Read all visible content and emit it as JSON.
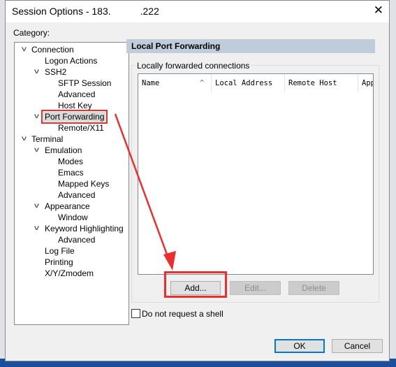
{
  "window": {
    "title": "Session Options - 183.   .222",
    "close_icon": "close-icon"
  },
  "category_label": "Category:",
  "tree": [
    {
      "label": "Connection",
      "level": 0,
      "expanded": true
    },
    {
      "label": "Logon Actions",
      "level": 1
    },
    {
      "label": "SSH2",
      "level": 1,
      "expanded": true
    },
    {
      "label": "SFTP Session",
      "level": 2
    },
    {
      "label": "Advanced",
      "level": 2
    },
    {
      "label": "Host Key",
      "level": 2
    },
    {
      "label": "Port Forwarding",
      "level": 1,
      "expanded": true,
      "selected": true
    },
    {
      "label": "Remote/X11",
      "level": 2
    },
    {
      "label": "Terminal",
      "level": 0,
      "expanded": true
    },
    {
      "label": "Emulation",
      "level": 1,
      "expanded": true
    },
    {
      "label": "Modes",
      "level": 2
    },
    {
      "label": "Emacs",
      "level": 2
    },
    {
      "label": "Mapped Keys",
      "level": 2
    },
    {
      "label": "Advanced",
      "level": 2
    },
    {
      "label": "Appearance",
      "level": 1,
      "expanded": true
    },
    {
      "label": "Window",
      "level": 2
    },
    {
      "label": "Keyword Highlighting",
      "level": 1,
      "expanded": true
    },
    {
      "label": "Advanced",
      "level": 2
    },
    {
      "label": "Log File",
      "level": 1
    },
    {
      "label": "Printing",
      "level": 1
    },
    {
      "label": "X/Y/Zmodem",
      "level": 1
    }
  ],
  "panel": {
    "header": "Local Port Forwarding",
    "group_label": "Locally forwarded connections",
    "columns": [
      "Name",
      "Local Address",
      "Remote Host",
      "App"
    ],
    "buttons": {
      "add": "Add...",
      "edit": "Edit...",
      "delete": "Delete"
    },
    "no_shell_label": "Do not request a shell",
    "no_shell_checked": false
  },
  "footer": {
    "ok": "OK",
    "cancel": "Cancel"
  },
  "annotation_color": "#ee2d2d"
}
